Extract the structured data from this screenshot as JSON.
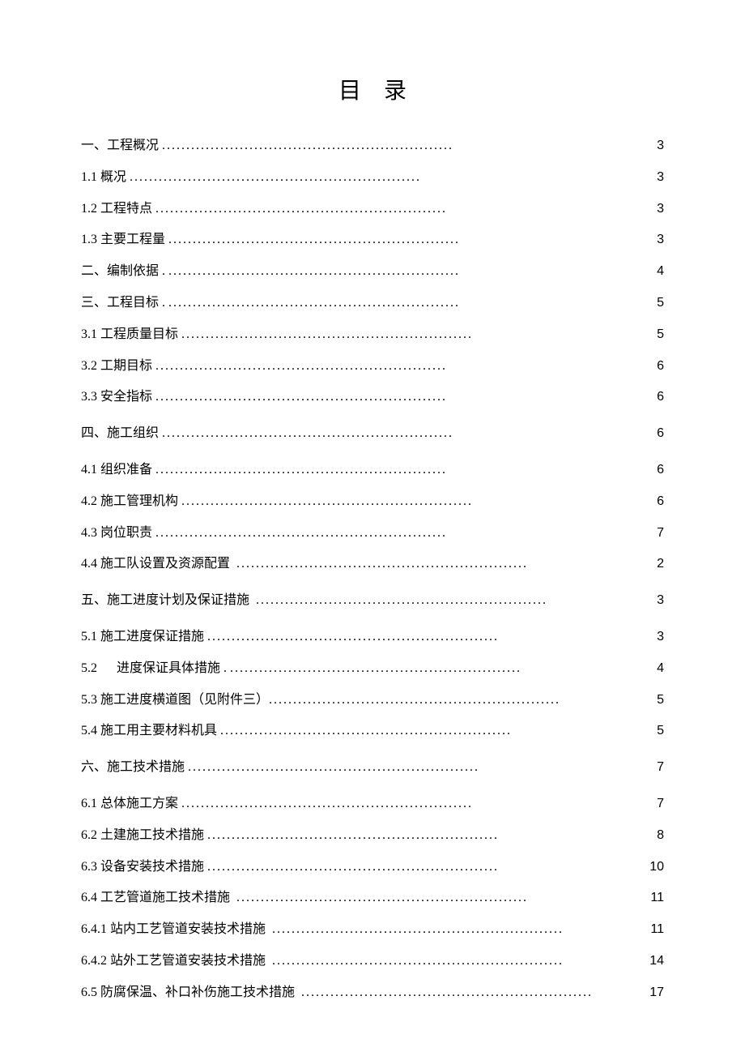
{
  "title": "目录",
  "entries": [
    {
      "label": "一、工程概况 ",
      "page": "3",
      "gap": false
    },
    {
      "label": "1.1 概况 ",
      "page": "3",
      "gap": false
    },
    {
      "label": "1.2 工程特点 ",
      "page": "3",
      "gap": false
    },
    {
      "label": "1.3 主要工程量 ",
      "page": "3",
      "gap": false
    },
    {
      "label": "二、编制依据 . ",
      "page": "4",
      "gap": false
    },
    {
      "label": "三、工程目标 . ",
      "page": "5",
      "gap": false
    },
    {
      "label": "3.1 工程质量目标 ",
      "page": "5",
      "gap": false
    },
    {
      "label": "3.2 工期目标 ",
      "page": "6",
      "gap": false
    },
    {
      "label": "3.3 安全指标 ",
      "page": "6",
      "gap": false
    },
    {
      "label": "四、施工组织 ",
      "page": "6",
      "gap": true
    },
    {
      "label": "4.1 组织准备 ",
      "page": "6",
      "gap": true
    },
    {
      "label": "4.2 施工管理机构 ",
      "page": "6",
      "gap": false
    },
    {
      "label": "4.3 岗位职责 ",
      "page": "7",
      "gap": false
    },
    {
      "label": "4.4 施工队设置及资源配置  ",
      "page": "2",
      "gap": false
    },
    {
      "label": "五、施工进度计划及保证措施  ",
      "page": "3",
      "gap": true
    },
    {
      "label": "5.1 施工进度保证措施 ",
      "page": "3",
      "gap": true
    },
    {
      "label": "5.2      进度保证具体措施 . ",
      "page": "4",
      "gap": false
    },
    {
      "label": "5.3 施工进度横道图（见附件三）",
      "page": "5",
      "gap": false
    },
    {
      "label": "5.4 施工用主要材料机具 ",
      "page": "5",
      "gap": false
    },
    {
      "label": "六、施工技术措施 ",
      "page": "7",
      "gap": true
    },
    {
      "label": "6.1 总体施工方案 ",
      "page": "7",
      "gap": true
    },
    {
      "label": "6.2 土建施工技术措施 ",
      "page": "8",
      "gap": false
    },
    {
      "label": "6.3 设备安装技术措施 ",
      "page": "10",
      "gap": false
    },
    {
      "label": "6.4 工艺管道施工技术措施  ",
      "page": "11",
      "gap": false
    },
    {
      "label": "6.4.1 站内工艺管道安装技术措施  ",
      "page": "11",
      "gap": false
    },
    {
      "label": "6.4.2 站外工艺管道安装技术措施  ",
      "page": "14",
      "gap": false
    },
    {
      "label": "6.5 防腐保温、补口补伤施工技术措施  ",
      "page": "17",
      "gap": false
    }
  ],
  "footer": ". . ."
}
